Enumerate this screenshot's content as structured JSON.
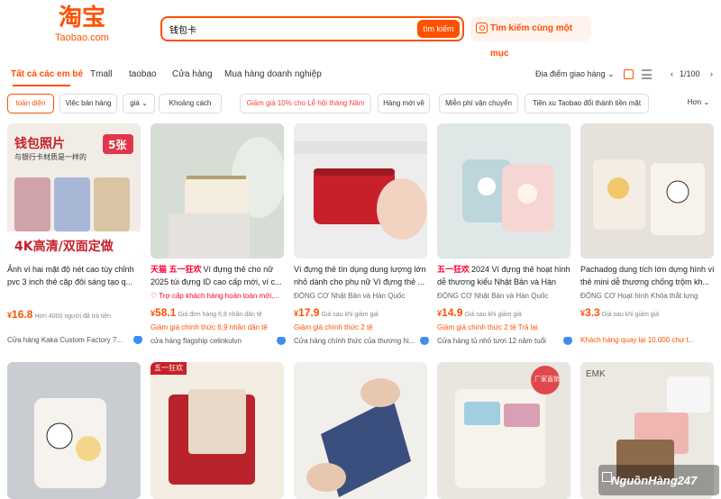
{
  "header": {
    "logo_cn": "淘宝",
    "logo_en": "Taobao.com",
    "search_value": "钱包卡",
    "search_button": "tìm kiếm",
    "image_search": "Tìm kiếm cùng một mục"
  },
  "tabs": [
    {
      "label": "Tất cả các em bé"
    },
    {
      "label": "Tmall"
    },
    {
      "label": "taobao"
    },
    {
      "label": "Cửa hàng"
    },
    {
      "label": "Mua hàng doanh nghiệp"
    }
  ],
  "view_controls": {
    "location": "Địa điểm giao hàng",
    "page": "1/100"
  },
  "filters": [
    {
      "label": "toàn diện"
    },
    {
      "label": "Việc bán hàng"
    },
    {
      "label": "giá"
    },
    {
      "label": "Khoảng cách"
    },
    {
      "label": "Giảm giá 10% cho Lễ hội tháng Năm"
    },
    {
      "label": "Hàng mới về"
    },
    {
      "label": "Miễn phí vận chuyển"
    },
    {
      "label": "Tiền xu Taobao đổi thành tiền mặt"
    },
    {
      "label": "Hơn"
    }
  ],
  "products": [
    {
      "title": "Ảnh ví hai mặt độ nét cao tùy chỉnh pvc 3 inch thẻ cặp đôi sáng tạo q...",
      "tag": "",
      "price": "16.8",
      "sold": "Hơn 4000 người đã trả tiền",
      "shop": "Cửa hàng Kaka Custom Factory 7",
      "shop_more": "...",
      "meta1": "",
      "meta2": "",
      "image_text_1": "钱包照片",
      "image_text_2": "与银行卡材质是一样的",
      "image_text_3": "5张",
      "image_text_4": "4K高清/双面定做",
      "colors": [
        "#e8e3dc",
        "#ffffff"
      ]
    },
    {
      "title": "Ví đựng thẻ cho nữ 2025 túi đựng ID cao cấp mới, ví c...",
      "tag": "天猫 五一狂欢",
      "price": "58.1",
      "sold": "Giá đơn hàng 6,9 nhân dân tệ",
      "meta1": "Trợ cấp khách hàng hoàn toàn mới,...",
      "meta2": "Giảm giá chính thức 6,9 nhân dân tệ",
      "shop": "cửa hàng flagship celinkulvn",
      "shop_more": "",
      "colors": [
        "#cfd8d0",
        "#f3eee4"
      ]
    },
    {
      "title": "Ví đựng thẻ tín dụng dung lượng lớn nhỏ dành cho phụ nữ Ví đựng thẻ ...",
      "tag": "",
      "price": "17.9",
      "sold": "Giá sau khi giảm giá",
      "meta1": "ĐỘNG CƠ Nhật Bản và Hàn Quốc",
      "meta2": "Giảm giá chính thức 2 tệ",
      "shop": "Cửa hàng chính thức của thương hi...",
      "shop_more": "",
      "colors": [
        "#e8e8e8",
        "#c8202a"
      ]
    },
    {
      "title": "2024 Ví đựng thẻ hoạt hình dễ thương kiểu Nhật Bản và Hàn Quốc...",
      "tag": "五一狂欢",
      "price": "14.9",
      "sold": "Giá sau khi giảm giá",
      "meta1": "ĐỘNG CƠ Nhật Bản và Hàn Quốc",
      "meta2": "Giảm giá chính thức 2 tệ Trả lại",
      "shop": "Cửa hàng tủ nhỏ tươi 12 năm tuổi",
      "shop_more": "",
      "colors": [
        "#d8e6e6",
        "#f5d2cf"
      ]
    },
    {
      "title": "Pachadog dung tích lớn dựng hình ví thẻ mini dễ thương chống trộm kh...",
      "tag": "",
      "price": "3.3",
      "sold": "Giá sau khi giảm giá",
      "meta1": "ĐỘNG CƠ Hoạt hình Khóa thắt lưng",
      "meta2": "Khách hàng quay lại 10.000 chư t...",
      "shop": "",
      "shop_more": "",
      "colors": [
        "#e6e0d8",
        "#f2eee6"
      ]
    },
    {
      "colors": [
        "#c9cdd2",
        "#f5f2ee"
      ]
    },
    {
      "colors": [
        "#b8232c",
        "#f5efe5"
      ],
      "badge": "五一狂欢"
    },
    {
      "colors": [
        "#f0eeec",
        "#3b4f7e"
      ]
    },
    {
      "colors": [
        "#e9e6df",
        "#d99fb5"
      ],
      "badge": "厂家直销"
    },
    {
      "colors": [
        "#ece8e2",
        "#8c6a4b"
      ],
      "badge": "EMK"
    }
  ],
  "watermark": "NguồnHàng247"
}
